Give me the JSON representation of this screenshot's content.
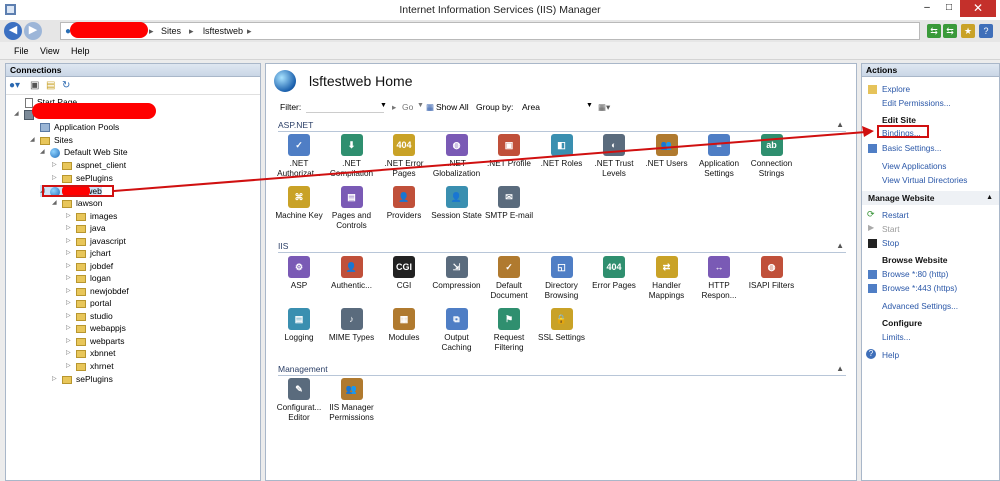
{
  "window": {
    "title": "Internet Information Services (IIS) Manager",
    "minimize": "–",
    "maximize": "□",
    "close": "✕"
  },
  "address": {
    "crumbs": [
      "Sites",
      "lsftestweb"
    ]
  },
  "menu": [
    "File",
    "View",
    "Help"
  ],
  "connections": {
    "title": "Connections",
    "tree": [
      {
        "label": "Start Page",
        "icon": "start-page-icon"
      },
      {
        "label": "",
        "icon": "server-icon"
      },
      {
        "label": "Application Pools",
        "icon": "app-pools-icon"
      },
      {
        "label": "Sites",
        "icon": "sites-icon"
      },
      {
        "label": "Default Web Site",
        "icon": "globe-icon"
      },
      {
        "label": "aspnet_client",
        "icon": "folder-icon"
      },
      {
        "label": "sePlugins",
        "icon": "folder-icon"
      },
      {
        "label": "lsftestweb",
        "icon": "globe-icon"
      },
      {
        "label": "lawson",
        "icon": "folder-icon"
      },
      {
        "label": "images",
        "icon": "folder-icon"
      },
      {
        "label": "java",
        "icon": "folder-icon"
      },
      {
        "label": "javascript",
        "icon": "folder-icon"
      },
      {
        "label": "jchart",
        "icon": "folder-icon"
      },
      {
        "label": "jobdef",
        "icon": "folder-icon"
      },
      {
        "label": "logan",
        "icon": "folder-icon"
      },
      {
        "label": "newjobdef",
        "icon": "folder-icon"
      },
      {
        "label": "portal",
        "icon": "folder-icon"
      },
      {
        "label": "studio",
        "icon": "folder-icon"
      },
      {
        "label": "webappjs",
        "icon": "folder-icon"
      },
      {
        "label": "webparts",
        "icon": "folder-icon"
      },
      {
        "label": "xbnnet",
        "icon": "folder-icon"
      },
      {
        "label": "xhrnet",
        "icon": "folder-icon"
      },
      {
        "label": "sePlugins",
        "icon": "folder-icon"
      }
    ]
  },
  "home": {
    "title": "lsftestweb Home",
    "filter_label": "Filter:",
    "go_label": "Go",
    "show_all_label": "Show All",
    "group_by_label": "Group by:",
    "group_by_value": "Area"
  },
  "sections": [
    {
      "name": "ASP.NET",
      "features": [
        {
          "label": ".NET Authorizat...",
          "icon": "authorization-icon"
        },
        {
          "label": ".NET Compilation",
          "icon": "compilation-icon"
        },
        {
          "label": ".NET Error Pages",
          "icon": "error-pages-icon"
        },
        {
          "label": ".NET Globalization",
          "icon": "globalization-icon"
        },
        {
          "label": ".NET Profile",
          "icon": "profile-icon"
        },
        {
          "label": ".NET Roles",
          "icon": "roles-icon"
        },
        {
          "label": ".NET Trust Levels",
          "icon": "trust-levels-icon"
        },
        {
          "label": ".NET Users",
          "icon": "users-icon"
        },
        {
          "label": "Application Settings",
          "icon": "app-settings-icon"
        },
        {
          "label": "Connection Strings",
          "icon": "connection-strings-icon"
        },
        {
          "label": "Machine Key",
          "icon": "machine-key-icon"
        },
        {
          "label": "Pages and Controls",
          "icon": "pages-controls-icon"
        },
        {
          "label": "Providers",
          "icon": "providers-icon"
        },
        {
          "label": "Session State",
          "icon": "session-state-icon"
        },
        {
          "label": "SMTP E-mail",
          "icon": "smtp-icon"
        }
      ]
    },
    {
      "name": "IIS",
      "features": [
        {
          "label": "ASP",
          "icon": "asp-icon"
        },
        {
          "label": "Authentic...",
          "icon": "authentication-icon"
        },
        {
          "label": "CGI",
          "icon": "cgi-icon"
        },
        {
          "label": "Compression",
          "icon": "compression-icon"
        },
        {
          "label": "Default Document",
          "icon": "default-document-icon"
        },
        {
          "label": "Directory Browsing",
          "icon": "directory-browsing-icon"
        },
        {
          "label": "Error Pages",
          "icon": "error-pages-icon"
        },
        {
          "label": "Handler Mappings",
          "icon": "handler-mappings-icon"
        },
        {
          "label": "HTTP Respon...",
          "icon": "http-response-icon"
        },
        {
          "label": "ISAPI Filters",
          "icon": "isapi-filters-icon"
        },
        {
          "label": "Logging",
          "icon": "logging-icon"
        },
        {
          "label": "MIME Types",
          "icon": "mime-types-icon"
        },
        {
          "label": "Modules",
          "icon": "modules-icon"
        },
        {
          "label": "Output Caching",
          "icon": "output-caching-icon"
        },
        {
          "label": "Request Filtering",
          "icon": "request-filtering-icon"
        },
        {
          "label": "SSL Settings",
          "icon": "ssl-settings-icon"
        }
      ]
    },
    {
      "name": "Management",
      "features": [
        {
          "label": "Configurat... Editor",
          "icon": "config-editor-icon"
        },
        {
          "label": "IIS Manager Permissions",
          "icon": "permissions-icon"
        }
      ]
    }
  ],
  "actions": {
    "title": "Actions",
    "explore": "Explore",
    "edit_permissions": "Edit Permissions...",
    "edit_site": "Edit Site",
    "bindings": "Bindings...",
    "basic_settings": "Basic Settings...",
    "view_applications": "View Applications",
    "view_virtual_directories": "View Virtual Directories",
    "manage_website": "Manage Website",
    "restart": "Restart",
    "start": "Start",
    "stop": "Stop",
    "browse_website": "Browse Website",
    "browse_80": "Browse *:80 (http)",
    "browse_443": "Browse *:443 (https)",
    "advanced_settings": "Advanced Settings...",
    "configure": "Configure",
    "limits": "Limits...",
    "help": "Help"
  },
  "colors": {
    "accent": "#2a57a8",
    "highlight_red": "#d01010"
  }
}
